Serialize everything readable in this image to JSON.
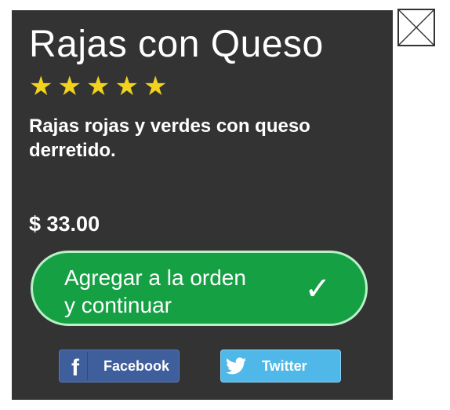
{
  "product": {
    "title": "Rajas con Queso",
    "rating": 5,
    "rating_max": 5,
    "star_glyph": "★",
    "description": "Rajas rojas y verdes con queso derretido.",
    "price": "$ 33.00"
  },
  "actions": {
    "add_label": "Agregar a la orden\ny continuar",
    "add_icon": "✓"
  },
  "share": {
    "facebook_label": "Facebook",
    "facebook_icon": "f",
    "twitter_label": "Twitter"
  },
  "colors": {
    "panel": "#333333",
    "star": "#f1d21e",
    "add_button": "#16a044",
    "facebook": "#3f5e9c",
    "twitter": "#4fb8e8"
  }
}
